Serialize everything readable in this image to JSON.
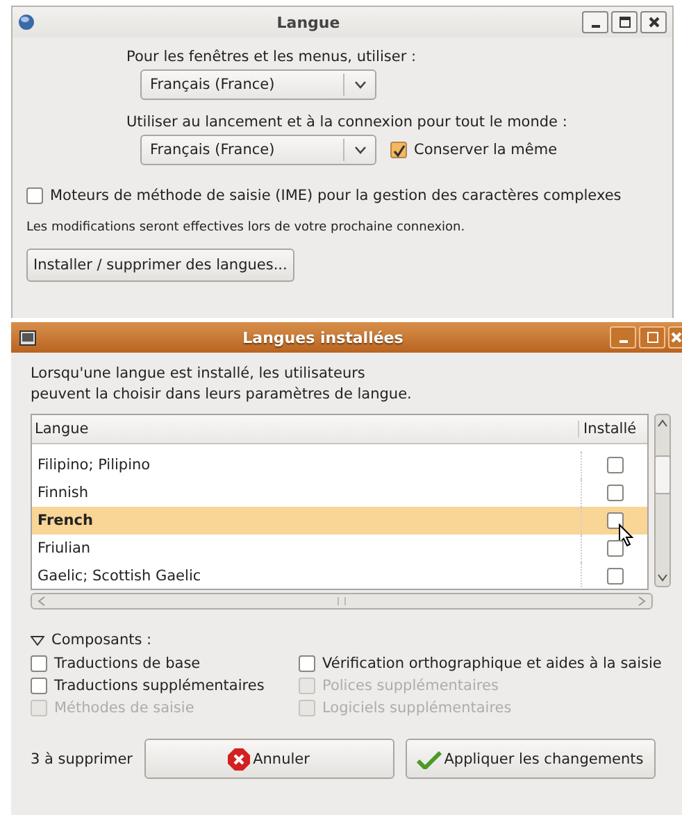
{
  "main_window": {
    "title": "Langue",
    "windows_label": "Pour les fenêtres et les menus, utiliser :",
    "windows_language": "Français (France)",
    "login_label": "Utiliser au lancement et à la connexion pour tout le monde :",
    "login_language": "Français (France)",
    "keep_same": {
      "label": "Conserver la même",
      "checked": true
    },
    "ime": {
      "label": "Moteurs de méthode de saisie (IME) pour la gestion des caractères complexes",
      "checked": false
    },
    "note": "Les modifications seront effectives lors de votre prochaine connexion.",
    "install_button": "Installer / supprimer des langues..."
  },
  "installed_window": {
    "title": "Langues installées",
    "description": "Lorsqu'une langue est installé, les utilisateurs\npeuvent la choisir dans leurs paramètres de langue.",
    "table": {
      "columns": [
        "Langue",
        "Installé"
      ],
      "rows": [
        {
          "name": "Filipino; Pilipino",
          "installed": false,
          "selected": false
        },
        {
          "name": "Finnish",
          "installed": false,
          "selected": false
        },
        {
          "name": "French",
          "installed": false,
          "selected": true
        },
        {
          "name": "Friulian",
          "installed": false,
          "selected": false
        },
        {
          "name": "Gaelic; Scottish Gaelic",
          "installed": false,
          "selected": false
        }
      ]
    },
    "components_label": "Composants :",
    "components_expanded": true,
    "components": [
      {
        "label": "Traductions de base",
        "checked": false,
        "disabled": false
      },
      {
        "label": "Vérification orthographique et aides à la saisie",
        "checked": false,
        "disabled": false
      },
      {
        "label": "Traductions supplémentaires",
        "checked": false,
        "disabled": false
      },
      {
        "label": "Polices supplémentaires",
        "checked": false,
        "disabled": true
      },
      {
        "label": "Méthodes de saisie",
        "checked": false,
        "disabled": true
      },
      {
        "label": "Logiciels supplémentaires",
        "checked": false,
        "disabled": true
      }
    ],
    "pending": "3 à supprimer",
    "cancel_button": "Annuler",
    "apply_button": "Appliquer les changements"
  }
}
